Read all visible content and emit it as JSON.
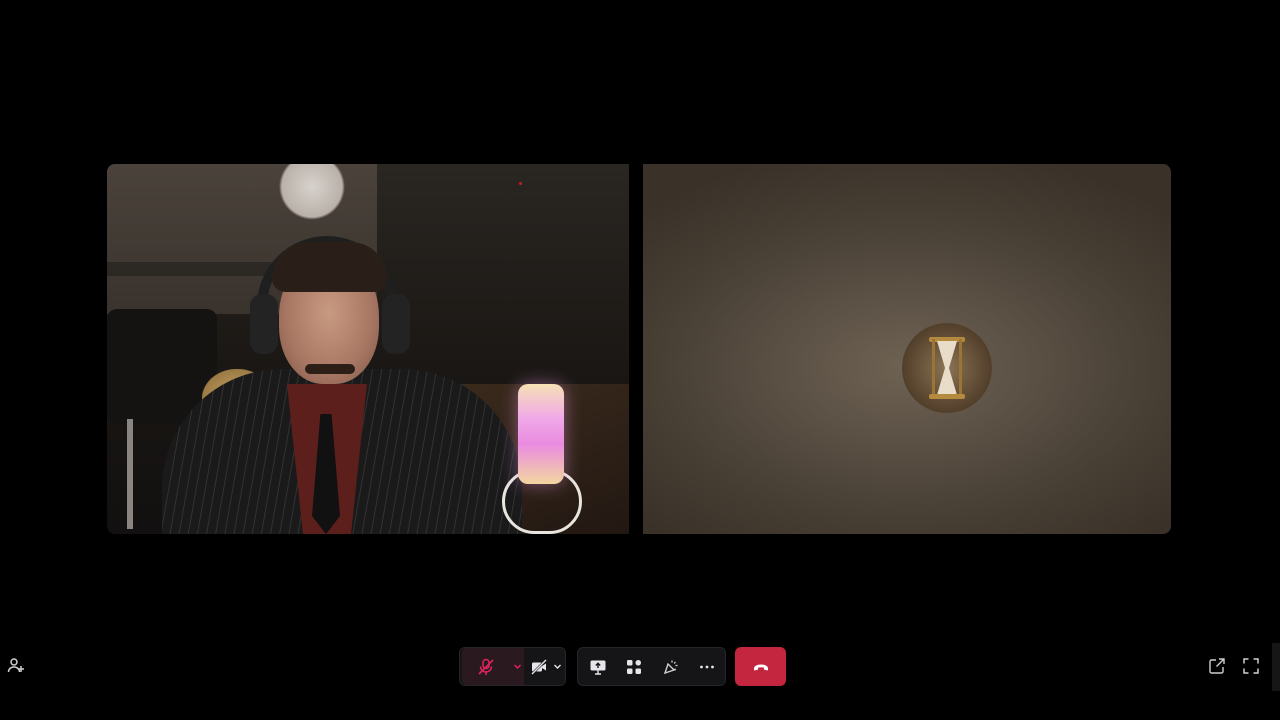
{
  "app": {
    "background_color": "#000000"
  },
  "participants": [
    {
      "tile": "left",
      "video_on": true
    },
    {
      "tile": "right",
      "video_on": false,
      "avatar_icon": "hourglass-icon"
    }
  ],
  "toolbar": {
    "add_participant_icon": "person-add-icon",
    "mic": {
      "state": "muted",
      "icon": "mic-off-icon",
      "accent": "#e0245e"
    },
    "camera": {
      "state": "off",
      "icon": "video-off-icon"
    },
    "share_icon": "screen-share-icon",
    "apps_icon": "apps-icon",
    "reactions_icon": "reactions-icon",
    "more_icon": "more-icon",
    "hangup": {
      "icon": "phone-hangup-icon",
      "color": "#c4253f"
    },
    "popout_icon": "popout-icon",
    "fullscreen_icon": "fullscreen-icon"
  }
}
